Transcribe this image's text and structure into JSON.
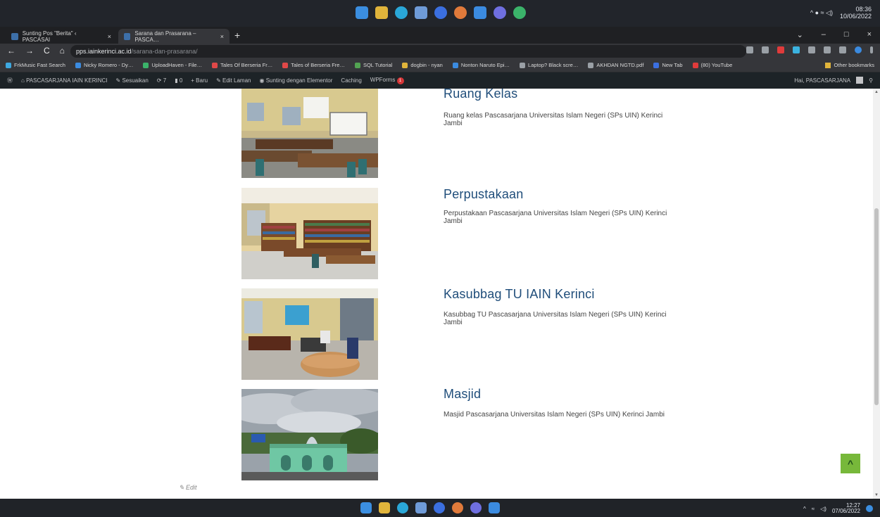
{
  "outer_taskbar": {
    "clock_time": "08:36",
    "clock_date": "10/06/2022",
    "tray": "^ ● ≈ ◁)"
  },
  "tabs": [
    {
      "label": "Sunting Pos \"Berita\" ‹ PASCASAI",
      "close": "×",
      "active": false
    },
    {
      "label": "Sarana dan Prasarana – PASCA…",
      "close": "×",
      "active": true
    }
  ],
  "new_tab": "+",
  "window_controls": [
    "⌄",
    "–",
    "□",
    "×"
  ],
  "toolbar": {
    "nav": [
      "←",
      "→",
      "C",
      "⌂"
    ],
    "url_host": "pps.iainkerinci.ac.id",
    "url_path": "/sarana-dan-prasarana/"
  },
  "bookmarks": [
    {
      "label": "FrkMusic Fast Search",
      "color": "#3ea8e0"
    },
    {
      "label": "Nicky Romero - Dy…",
      "color": "#3b8be0"
    },
    {
      "label": "UploadHaven - File…",
      "color": "#3bb36a"
    },
    {
      "label": "Tales Of Berseria Fr…",
      "color": "#e04848"
    },
    {
      "label": "Tales of Berseria Fre…",
      "color": "#e04848"
    },
    {
      "label": "SQL Tutorial",
      "color": "#52a352"
    },
    {
      "label": "dogbin - nyan",
      "color": "#e0b43b"
    },
    {
      "label": "Nonton Naruto Epi…",
      "color": "#3b8be0"
    },
    {
      "label": "Laptop? Black scre…",
      "color": "#9aa0a6"
    },
    {
      "label": "AKHDAN NGTD.pdf",
      "color": "#9aa0a6"
    },
    {
      "label": "New Tab",
      "color": "#3b6fe0"
    },
    {
      "label": "(80) YouTube",
      "color": "#e03b3b"
    }
  ],
  "other_bookmarks": "Other bookmarks",
  "adminbar": {
    "items": [
      "PASCASARJANA IAIN KERINCI",
      "Sesuaikan",
      "7",
      "0",
      "Baru",
      "Edit Laman",
      "Sunting dengan Elementor",
      "Caching",
      "WPForms"
    ],
    "wpforms_badge": "1",
    "greeting": "Hai, PASCASARJANA"
  },
  "facilities": [
    {
      "title": "Ruang Kelas",
      "description": "Ruang kelas Pascasarjana Universitas Islam Negeri (SPs UIN) Kerinci Jambi"
    },
    {
      "title": "Perpustakaan",
      "description": "Perpustakaan Pascasarjana Universitas Islam Negeri (SPs UIN) Kerinci Jambi"
    },
    {
      "title": "Kasubbag TU IAIN Kerinci",
      "description": "Kasubbag TU Pascasarjana Universitas Islam Negeri (SPs UIN) Kerinci Jambi"
    },
    {
      "title": "Masjid",
      "description": "Masjid Pascasarjana Universitas Islam Negeri (SPs UIN) Kerinci Jambi"
    }
  ],
  "edit_link": "Edit",
  "back_to_top": "^",
  "taskbar": {
    "clock_time": "12:27",
    "clock_date": "07/06/2022"
  },
  "colors": {
    "title_blue": "#1f4d7a",
    "accent_green": "#77b83a",
    "admin_bar": "#1d2327"
  }
}
